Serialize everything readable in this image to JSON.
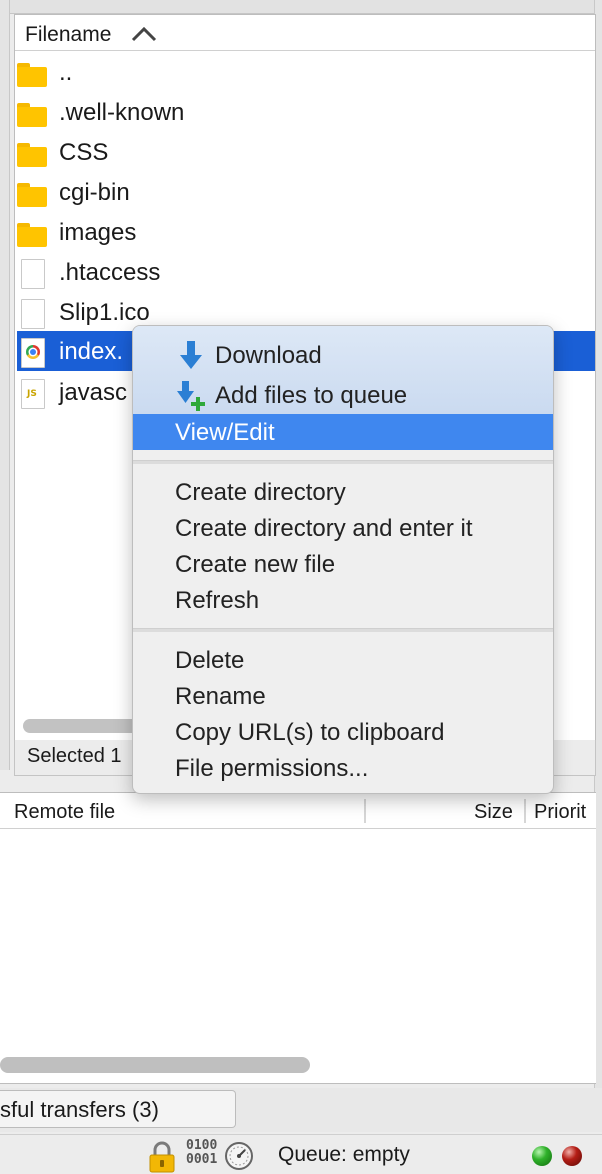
{
  "file_list": {
    "column_filename": "Filename",
    "rows": [
      {
        "name": "..",
        "type": "folder"
      },
      {
        "name": ".well-known",
        "type": "folder"
      },
      {
        "name": "CSS",
        "type": "folder"
      },
      {
        "name": "cgi-bin",
        "type": "folder"
      },
      {
        "name": "images",
        "type": "folder"
      },
      {
        "name": ".htaccess",
        "type": "file"
      },
      {
        "name": "Slip1.ico",
        "type": "file"
      },
      {
        "name": "index.",
        "type": "html-file",
        "selected": true
      },
      {
        "name": "javasc",
        "type": "js-file"
      }
    ],
    "status_text": "Selected 1"
  },
  "context_menu": {
    "download": "Download",
    "add_to_queue": "Add files to queue",
    "view_edit": "View/Edit",
    "create_directory": "Create directory",
    "create_directory_enter": "Create directory and enter it",
    "create_new_file": "Create new file",
    "refresh": "Refresh",
    "delete": "Delete",
    "rename": "Rename",
    "copy_url": "Copy URL(s) to clipboard",
    "file_permissions": "File permissions..."
  },
  "queue": {
    "col_remote_file": "Remote file",
    "col_size": "Size",
    "col_priority": "Priorit"
  },
  "tabs": {
    "successful_transfers": "sful transfers (3)"
  },
  "statusbar": {
    "binary_top": "0100",
    "binary_bottom": "0001",
    "queue_status": "Queue: empty"
  },
  "colors": {
    "selection": "#1a5fd6",
    "menu_highlight": "#3f87ef",
    "folder": "#ffc400"
  }
}
